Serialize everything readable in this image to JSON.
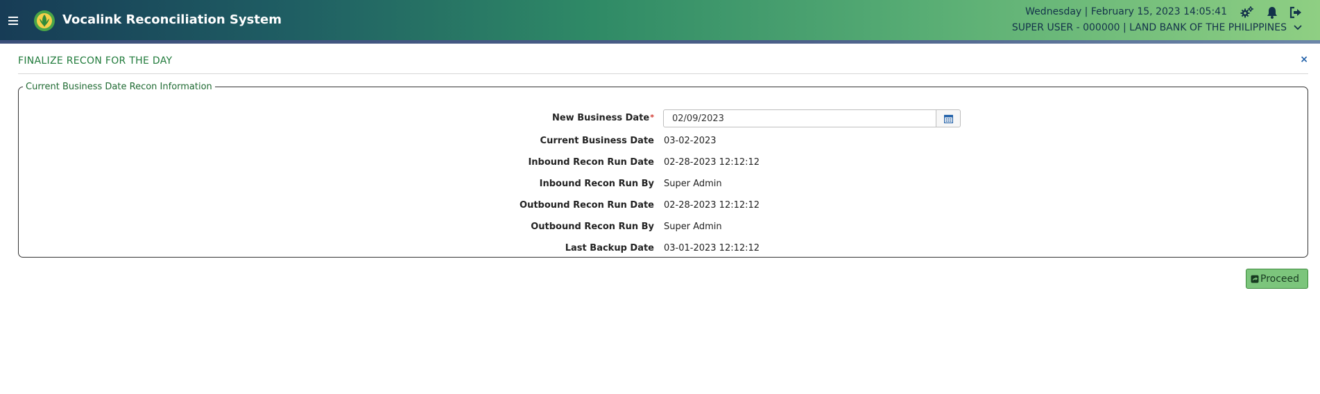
{
  "header": {
    "app_title": "Vocalink Reconciliation System",
    "datetime": "Wednesday | February 15, 2023 14:05:41",
    "user_info": "SUPER USER - 000000 | LAND BANK OF THE PHILIPPINES",
    "icons": [
      "menu-icon",
      "logo-icon",
      "settings-icon",
      "bell-icon",
      "logout-icon",
      "chevron-down-icon"
    ]
  },
  "page": {
    "title": "FINALIZE RECON FOR THE DAY",
    "close_label": "×"
  },
  "section": {
    "legend": "Current Business Date Recon Information",
    "fields": [
      {
        "label": "New Business Date",
        "required_mark": "*",
        "value": "02/09/2023"
      },
      {
        "label": "Current Business Date",
        "value": "03-02-2023"
      },
      {
        "label": "Inbound Recon Run Date",
        "value": "02-28-2023 12:12:12"
      },
      {
        "label": "Inbound Recon Run By",
        "value": "Super Admin"
      },
      {
        "label": "Outbound Recon Run Date",
        "value": "02-28-2023 12:12:12"
      },
      {
        "label": "Outbound Recon Run By",
        "value": "Super Admin"
      },
      {
        "label": "Last Backup Date",
        "value": "03-01-2023 12:12:12"
      }
    ]
  },
  "actions": {
    "proceed_label": "Proceed"
  },
  "colors": {
    "brand_green": "#1f7a3a",
    "button_green": "#7cc57c",
    "link_blue": "#1f5fa8"
  }
}
